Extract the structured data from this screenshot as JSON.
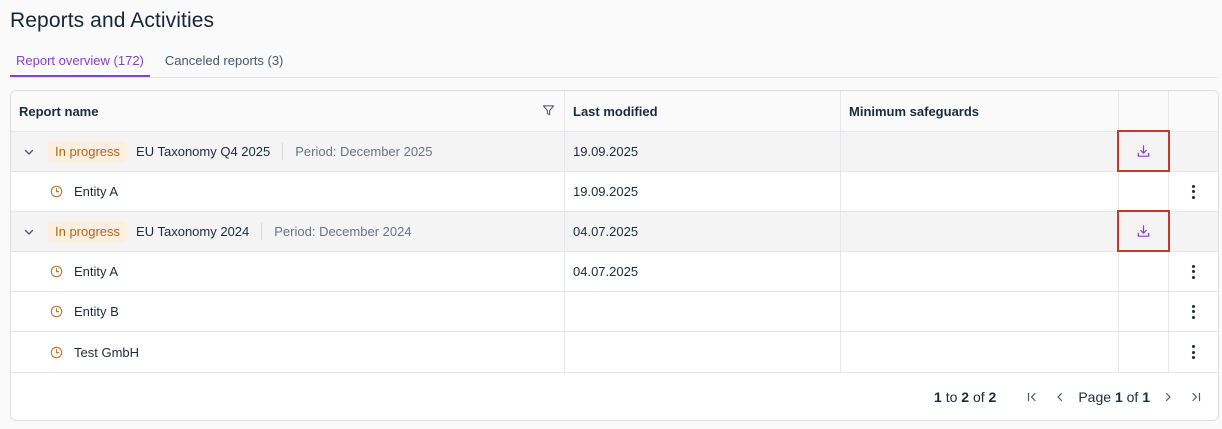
{
  "title": "Reports and Activities",
  "tabs": [
    {
      "label": "Report overview (172)",
      "active": true
    },
    {
      "label": "Canceled reports (3)",
      "active": false
    }
  ],
  "columns": {
    "report_name": "Report name",
    "last_modified": "Last modified",
    "minimum_safeguards": "Minimum safeguards"
  },
  "groups": [
    {
      "status": "In progress",
      "name": "EU Taxonomy Q4 2025",
      "period": "Period: December 2025",
      "last_modified": "19.09.2025",
      "entities": [
        {
          "name": "Entity A",
          "last_modified": "19.09.2025"
        }
      ]
    },
    {
      "status": "In progress",
      "name": "EU Taxonomy 2024",
      "period": "Period: December 2024",
      "last_modified": "04.07.2025",
      "entities": [
        {
          "name": "Entity A",
          "last_modified": "04.07.2025"
        },
        {
          "name": "Entity B",
          "last_modified": ""
        },
        {
          "name": "Test GmbH",
          "last_modified": ""
        }
      ]
    }
  ],
  "pagination": {
    "from": "1",
    "to_word": "to",
    "to": "2",
    "of_word": "of",
    "total": "2",
    "page_word": "Page",
    "page": "1",
    "pages": "1"
  },
  "colors": {
    "accent": "#8b3fc9",
    "status_bg": "#fbefe2",
    "status_text": "#b4651c",
    "highlight_border": "#c0392b"
  },
  "icons": {
    "filter": "filter-icon",
    "expand": "chevron-down-icon",
    "entity": "clock-icon",
    "download": "download-icon",
    "more": "more-vertical-icon"
  }
}
